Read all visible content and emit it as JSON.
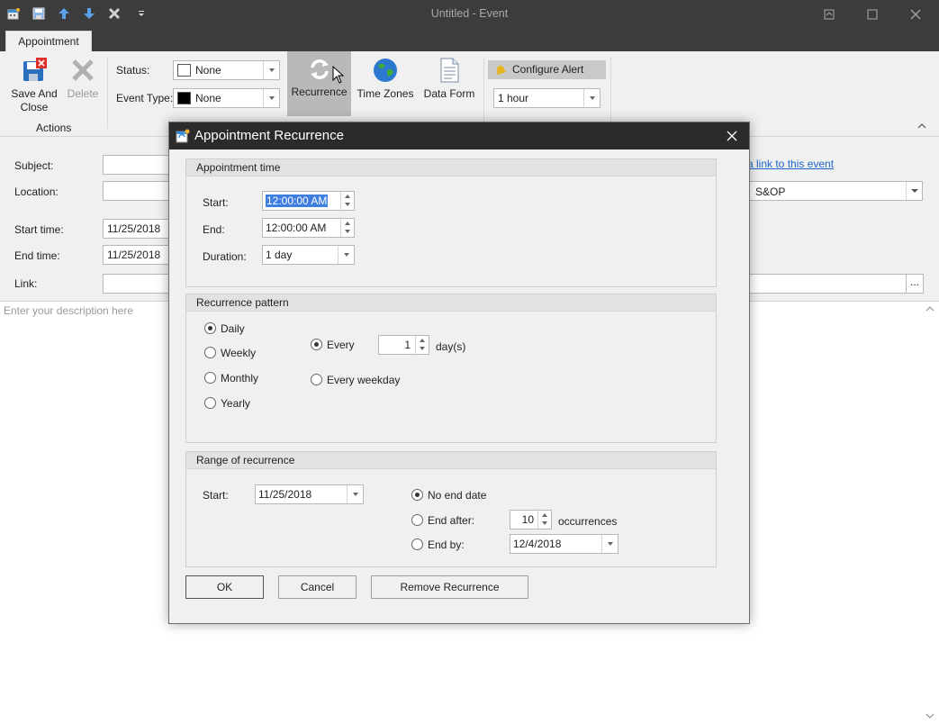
{
  "window": {
    "title": "Untitled - Event"
  },
  "ribbon": {
    "tab": "Appointment",
    "save_and_close": "Save And Close",
    "save_and_close_line1": "Save And",
    "save_and_close_line2": "Close",
    "delete": "Delete",
    "actions_group": "Actions",
    "status_label": "Status:",
    "status_value": "None",
    "event_type_label": "Event Type:",
    "event_type_value": "None",
    "recurrence": "Recurrence",
    "time_zones": "Time Zones",
    "data_form": "Data Form",
    "configure_alert": "Configure Alert",
    "alert_value": "1 hour"
  },
  "form": {
    "subject_label": "Subject:",
    "location_label": "Location:",
    "start_time_label": "Start time:",
    "start_date": "11/25/2018",
    "end_time_label": "End time:",
    "end_date": "11/25/2018",
    "link_label": "Link:",
    "link_to_event": "a link to this event",
    "resource_value": "S&OP",
    "ellipsis": "...",
    "description_placeholder": "Enter your description here"
  },
  "dialog": {
    "title": "Appointment Recurrence",
    "appointment_time": {
      "heading": "Appointment time",
      "start_label": "Start:",
      "start_value": "12:00:00 AM",
      "end_label": "End:",
      "end_value": "12:00:00 AM",
      "duration_label": "Duration:",
      "duration_value": "1 day"
    },
    "pattern": {
      "heading": "Recurrence pattern",
      "daily": "Daily",
      "weekly": "Weekly",
      "monthly": "Monthly",
      "yearly": "Yearly",
      "every": "Every",
      "every_value": "1",
      "days_unit": "day(s)",
      "every_weekday": "Every weekday"
    },
    "range": {
      "heading": "Range of recurrence",
      "start_label": "Start:",
      "start_value": "11/25/2018",
      "no_end_date": "No end date",
      "end_after": "End after:",
      "occurrences_value": "10",
      "occurrences_unit": "occurrences",
      "end_by": "End by:",
      "end_by_value": "12/4/2018"
    },
    "buttons": {
      "ok": "OK",
      "cancel": "Cancel",
      "remove": "Remove Recurrence"
    }
  }
}
